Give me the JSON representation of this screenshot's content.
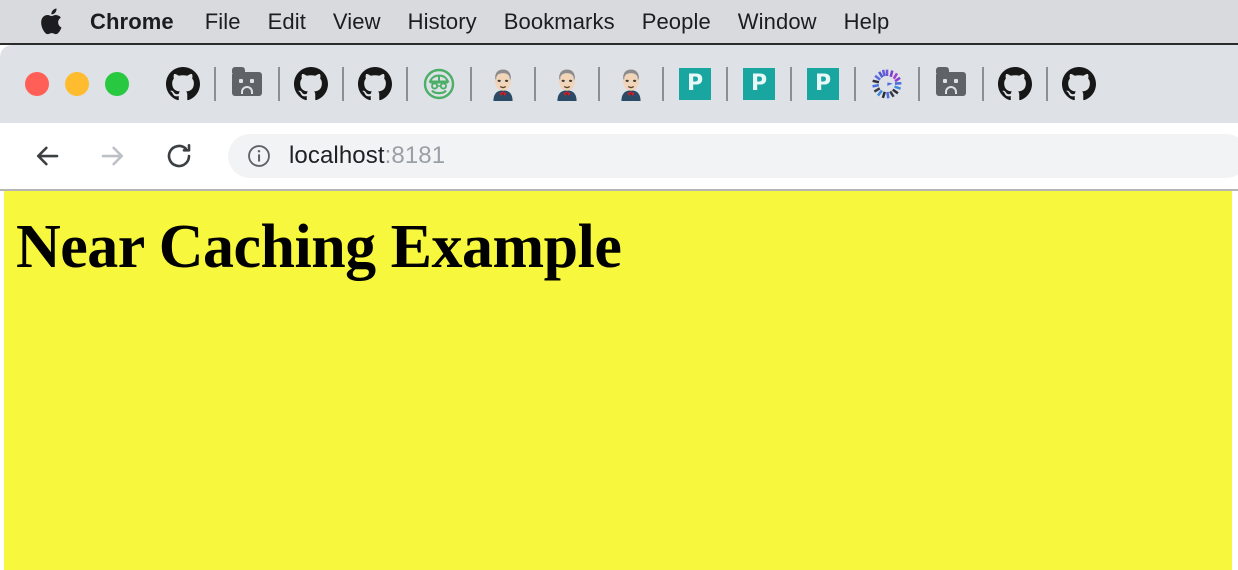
{
  "menubar": {
    "apple_icon": "apple-logo",
    "items": [
      {
        "label": "Chrome",
        "bold": true
      },
      {
        "label": "File",
        "bold": false
      },
      {
        "label": "Edit",
        "bold": false
      },
      {
        "label": "View",
        "bold": false
      },
      {
        "label": "History",
        "bold": false
      },
      {
        "label": "Bookmarks",
        "bold": false
      },
      {
        "label": "People",
        "bold": false
      },
      {
        "label": "Window",
        "bold": false
      },
      {
        "label": "Help",
        "bold": false
      }
    ]
  },
  "window": {
    "traffic_lights": [
      {
        "name": "close-button",
        "color": "#ff5f57"
      },
      {
        "name": "minimize-button",
        "color": "#febc2e"
      },
      {
        "name": "maximize-button",
        "color": "#28c840"
      }
    ],
    "bookmarks_bar": [
      {
        "icon": "github-icon",
        "separator_after": true
      },
      {
        "icon": "sad-folder-icon",
        "separator_after": true
      },
      {
        "icon": "github-icon",
        "separator_after": true
      },
      {
        "icon": "github-icon",
        "separator_after": true
      },
      {
        "icon": "sonarqube-icon",
        "separator_after": true
      },
      {
        "icon": "jenkins-icon",
        "separator_after": true
      },
      {
        "icon": "jenkins-icon",
        "separator_after": true
      },
      {
        "icon": "jenkins-icon",
        "separator_after": true
      },
      {
        "icon": "phabricator-p-icon",
        "label": "P",
        "separator_after": true
      },
      {
        "icon": "phabricator-p-icon",
        "label": "P",
        "separator_after": true
      },
      {
        "icon": "phabricator-p-icon",
        "label": "P",
        "separator_after": true
      },
      {
        "icon": "radial-burst-icon",
        "separator_after": true
      },
      {
        "icon": "sad-folder-icon",
        "separator_after": true
      },
      {
        "icon": "github-icon",
        "separator_after": true
      },
      {
        "icon": "github-icon",
        "separator_after": false
      }
    ]
  },
  "toolbar": {
    "back_icon": "back-arrow-icon",
    "forward_icon": "forward-arrow-icon",
    "reload_icon": "reload-icon",
    "site_info_icon": "info-circle-icon",
    "url_host": "localhost",
    "url_port": ":8181",
    "url_full": "localhost:8181"
  },
  "page": {
    "heading": "Near Caching Example",
    "background_color": "#f7f73e",
    "text_color": "#000000"
  }
}
